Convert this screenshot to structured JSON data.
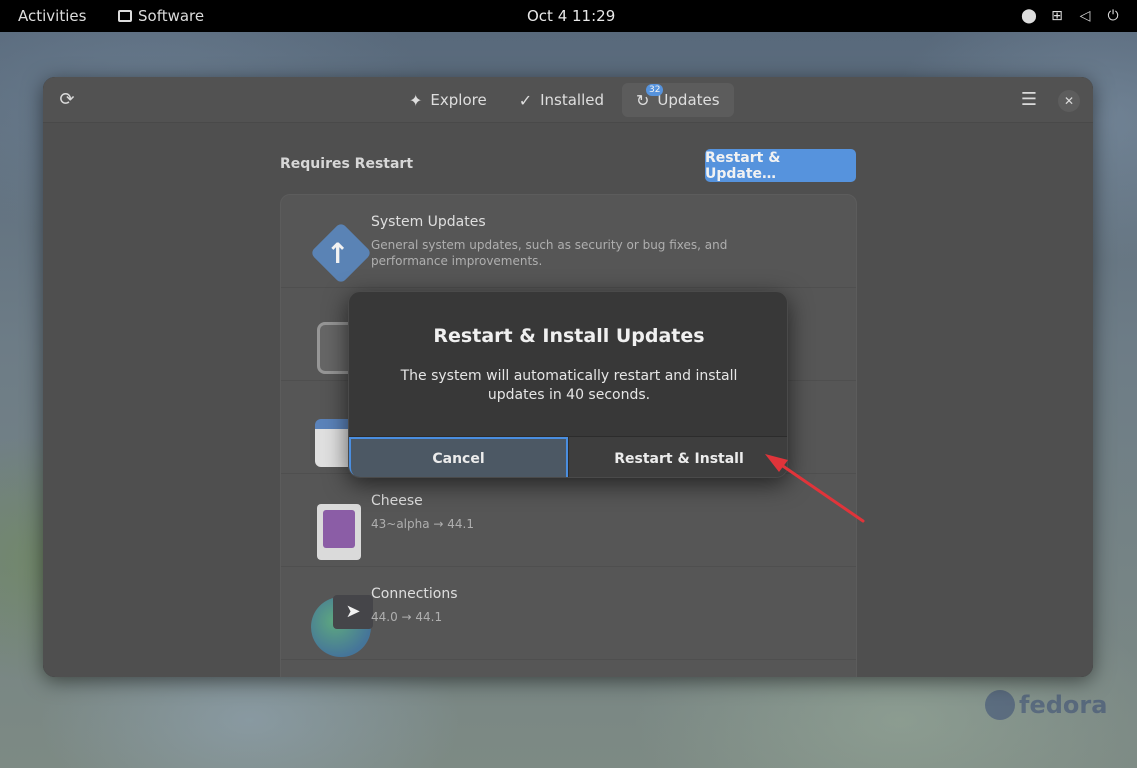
{
  "topbar": {
    "activities": "Activities",
    "app_name": "Software",
    "clock": "Oct 4  11:29"
  },
  "window": {
    "tabs": [
      {
        "label": "Explore",
        "icon": "sparkle-icon"
      },
      {
        "label": "Installed",
        "icon": "check-circle-icon"
      },
      {
        "label": "Updates",
        "icon": "refresh-icon",
        "badge": "32"
      }
    ],
    "active_tab": "Updates"
  },
  "updates": {
    "section_title": "Requires Restart",
    "action_button": "Restart & Update…",
    "items": [
      {
        "name": "System Updates",
        "desc": "General system updates, such as security or bug fixes, and performance improvements."
      },
      {
        "name": "",
        "desc": ""
      },
      {
        "name": "",
        "desc": ""
      },
      {
        "name": "Cheese",
        "desc": "43~alpha → 44.1"
      },
      {
        "name": "Connections",
        "desc": "44.0 → 44.1"
      }
    ]
  },
  "dialog": {
    "title": "Restart & Install Updates",
    "body": "The system will automatically restart and install updates in 40 seconds.",
    "cancel_label": "Cancel",
    "confirm_label": "Restart & Install"
  },
  "wallpaper": {
    "logo_text": "fedora"
  },
  "colors": {
    "accent": "#3584e4",
    "annotation_arrow": "#e0343a"
  }
}
